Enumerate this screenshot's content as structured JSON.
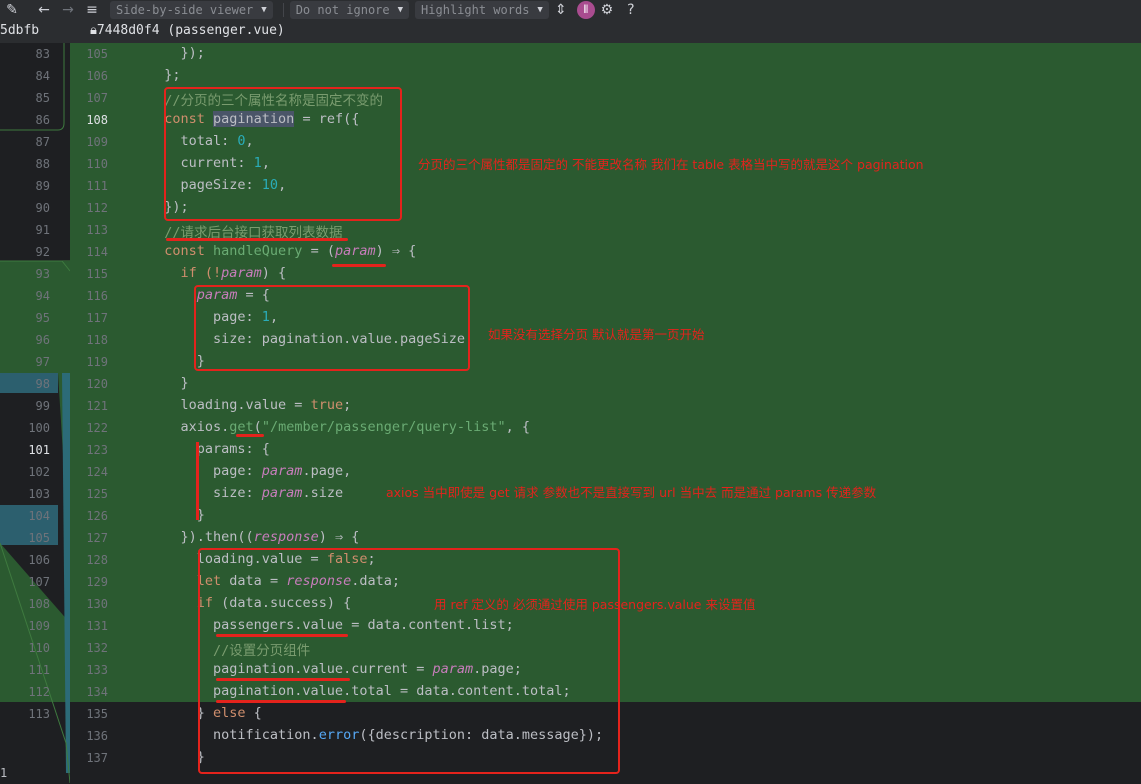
{
  "toolbar": {
    "viewer_label": "Side-by-side viewer",
    "ignore_label": "Do not ignore",
    "highlight_label": "Highlight words",
    "help_label": "?"
  },
  "header": {
    "left_hash": "5dbfb",
    "right_file": "7448d0f4 (passenger.vue)"
  },
  "left_line_numbers": [
    "83",
    "84",
    "85",
    "86",
    "87",
    "88",
    "89",
    "90",
    "91",
    "92",
    "93",
    "94",
    "95",
    "96",
    "97",
    "98",
    "99",
    "100",
    "101",
    "102",
    "103",
    "104",
    "105",
    "106",
    "107",
    "108",
    "109",
    "110",
    "111",
    "112",
    "113"
  ],
  "right_line_numbers": [
    "105",
    "106",
    "107",
    "108",
    "109",
    "110",
    "111",
    "112",
    "113",
    "114",
    "115",
    "116",
    "117",
    "118",
    "119",
    "120",
    "121",
    "122",
    "123",
    "124",
    "125",
    "126",
    "127",
    "128",
    "129",
    "130",
    "131",
    "132",
    "133",
    "134",
    "135",
    "136",
    "137"
  ],
  "current_right_line": "108",
  "current_left_line": "101",
  "bottom_left_label": "1",
  "code": {
    "l105": "    });",
    "l106": "  };",
    "l107": "  //分页的三个属性名称是固定不变的",
    "l108_a": "  const ",
    "l108_b": "pagination",
    "l108_c": " = ref({",
    "l109_a": "    total: ",
    "l109_b": "0",
    "l109_c": ",",
    "l110_a": "    current: ",
    "l110_b": "1",
    "l110_c": ",",
    "l111_a": "    pageSize: ",
    "l111_b": "10",
    "l111_c": ",",
    "l112": "  });",
    "l113": "  //请求后台接口获取列表数据",
    "l114_a": "  const ",
    "l114_b": "handleQuery",
    "l114_c": " = (",
    "l114_d": "param",
    "l114_e": ") ⇒ {",
    "l115_a": "    if (!",
    "l115_b": "param",
    "l115_c": ") {",
    "l116_a": "      ",
    "l116_b": "param",
    "l116_c": " = {",
    "l117_a": "        page: ",
    "l117_b": "1",
    "l117_c": ",",
    "l118": "        size: pagination.value.pageSize",
    "l119": "      }",
    "l120": "    }",
    "l121_a": "    loading.value = ",
    "l121_b": "true",
    "l121_c": ";",
    "l122_a": "    axios.",
    "l122_b": "get",
    "l122_c": "(",
    "l122_d": "\"/member/passenger/query-list\"",
    "l122_e": ", {",
    "l123": "      params: {",
    "l124_a": "        page: ",
    "l124_b": "param",
    "l124_c": ".page,",
    "l125_a": "        size: ",
    "l125_b": "param",
    "l125_c": ".size",
    "l126": "      }",
    "l127_a": "    }).then((",
    "l127_b": "response",
    "l127_c": ") ⇒ {",
    "l128_a": "      loading.value = ",
    "l128_b": "false",
    "l128_c": ";",
    "l129_a": "      ",
    "l129_b": "let",
    "l129_c": " data = ",
    "l129_d": "response",
    "l129_e": ".data;",
    "l130_a": "      ",
    "l130_b": "if",
    "l130_c": " (data.success) {",
    "l131": "        passengers.value = data.content.list;",
    "l132": "        //设置分页组件",
    "l133_a": "        pagination.value.current = ",
    "l133_b": "param",
    "l133_c": ".page;",
    "l134": "        pagination.value.total = data.content.total;",
    "l135_a": "      } ",
    "l135_b": "else",
    "l135_c": " {",
    "l136_a": "        notification.",
    "l136_b": "error",
    "l136_c": "({description: data.message});",
    "l137": "      }"
  },
  "annotations": {
    "a1": "分页的三个属性都是固定的 不能更改名称 我们在 table 表格当中写的就是这个 pagination",
    "a2": "如果没有选择分页 默认就是第一页开始",
    "a3": "axios 当中即使是 get 请求 参数也不是直接写到 url 当中去  而是通过 params 传递参数",
    "a4": "用 ref 定义的 必须通过使用 passengers.value 来设置值"
  },
  "colors": {
    "added_bg": "#2b5a30",
    "annotation_red": "#e4231c",
    "editor_bg": "#1e1f22"
  }
}
